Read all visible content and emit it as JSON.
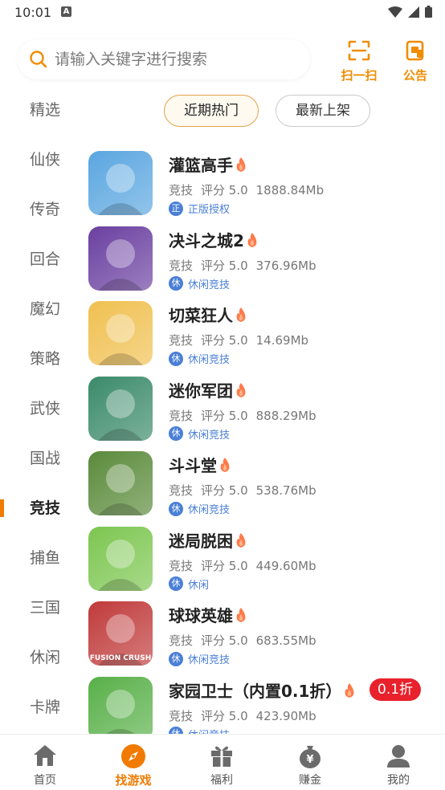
{
  "status_bar": {
    "time": "10:01"
  },
  "search": {
    "placeholder": "请输入关键字进行搜索"
  },
  "actions": {
    "scan_label": "扫一扫",
    "notice_label": "公告"
  },
  "sidebar": {
    "items": [
      {
        "label": "精选"
      },
      {
        "label": "仙侠"
      },
      {
        "label": "传奇"
      },
      {
        "label": "回合"
      },
      {
        "label": "魔幻"
      },
      {
        "label": "策略"
      },
      {
        "label": "武侠"
      },
      {
        "label": "国战"
      },
      {
        "label": "竞技",
        "active": true
      },
      {
        "label": "捕鱼"
      },
      {
        "label": "三国"
      },
      {
        "label": "休闲"
      },
      {
        "label": "卡牌"
      }
    ]
  },
  "filters": {
    "hot": "近期热门",
    "new": "最新上架"
  },
  "games": [
    {
      "name": "灌篮高手",
      "category": "竞技",
      "rating": "评分 5.0",
      "size": "1888.84Mb",
      "badge": "正",
      "tag": "正版授权",
      "icon_color": "#5aa6e0",
      "icon_name": "basketball-player-icon"
    },
    {
      "name": "决斗之城2",
      "category": "竞技",
      "rating": "评分 5.0",
      "size": "376.96Mb",
      "badge": "休",
      "tag": "休闲竞技",
      "icon_color": "#6a3fa0",
      "icon_name": "duelist-icon"
    },
    {
      "name": "切菜狂人",
      "category": "竞技",
      "rating": "评分 5.0",
      "size": "14.69Mb",
      "badge": "休",
      "tag": "休闲竞技",
      "icon_color": "#f0c050",
      "icon_name": "elf-girl-icon"
    },
    {
      "name": "迷你军团",
      "category": "竞技",
      "rating": "评分 5.0",
      "size": "888.29Mb",
      "badge": "休",
      "tag": "休闲竞技",
      "icon_color": "#3a8a6a",
      "icon_name": "general-icon"
    },
    {
      "name": "斗斗堂",
      "category": "竞技",
      "rating": "评分 5.0",
      "size": "538.76Mb",
      "badge": "休",
      "tag": "休闲竞技",
      "icon_color": "#5a8a3a",
      "icon_name": "soldier-icon"
    },
    {
      "name": "迷局脱困",
      "category": "竞技",
      "rating": "评分 5.0",
      "size": "449.60Mb",
      "badge": "休",
      "tag": "休闲",
      "icon_color": "#7cc650",
      "icon_name": "bow-icon"
    },
    {
      "name": "球球英雄",
      "category": "竞技",
      "rating": "评分 5.0",
      "size": "683.55Mb",
      "badge": "休",
      "tag": "休闲竞技",
      "icon_color": "#c03a3a",
      "icon_name": "fusion-ball-icon",
      "icon_text": "FUSION CRUSH"
    },
    {
      "name": "家园卫士（内置0.1折）",
      "category": "竞技",
      "rating": "评分 5.0",
      "size": "423.90Mb",
      "badge": "休",
      "tag": "休闲竞技",
      "icon_color": "#58b048",
      "icon_name": "crossbow-icon",
      "discount": "0.1折"
    }
  ],
  "bottom_nav": [
    {
      "label": "首页",
      "icon": "home-icon"
    },
    {
      "label": "找游戏",
      "icon": "compass-icon",
      "active": true
    },
    {
      "label": "福利",
      "icon": "gift-icon"
    },
    {
      "label": "赚金",
      "icon": "money-bag-icon"
    },
    {
      "label": "我的",
      "icon": "user-icon"
    }
  ],
  "colors": {
    "accent": "#f07b00",
    "tag_blue": "#4a7fd6",
    "discount_red": "#e8212c"
  }
}
